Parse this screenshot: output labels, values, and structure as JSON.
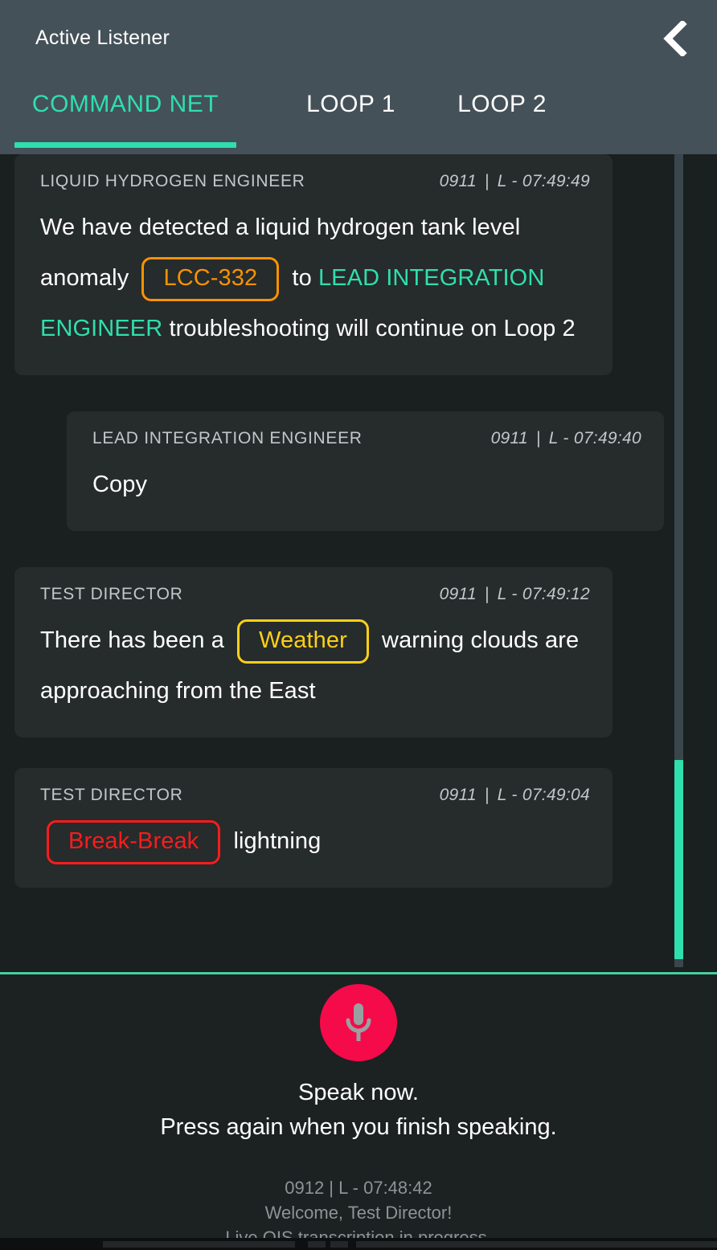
{
  "header": {
    "title": "Active Listener",
    "back_icon": "chevron-left-icon",
    "tabs": [
      {
        "label": "COMMAND NET",
        "active": true
      },
      {
        "label": "LOOP 1",
        "active": false
      },
      {
        "label": "LOOP 2",
        "active": false
      }
    ]
  },
  "colors": {
    "accent_green": "#2fdfae",
    "header_bg": "#455159",
    "card_bg": "#262b2c",
    "page_bg": "#1a1f20",
    "chip_orange": "#fb9200",
    "chip_yellow": "#fdd017",
    "chip_red": "#fa1c1c",
    "mic_red": "#f50a4a"
  },
  "messages": [
    {
      "speaker": "LIQUID HYDROGEN ENGINEER",
      "day": "0911",
      "time": "L - 07:49:49",
      "align": "left",
      "segments": [
        {
          "type": "text",
          "value": "We have detected a liquid hydrogen tank level anomaly "
        },
        {
          "type": "chip",
          "value": "LCC-332",
          "color": "orange"
        },
        {
          "type": "text",
          "value": " to "
        },
        {
          "type": "highlight",
          "value": "LEAD INTEGRATION ENGINEER"
        },
        {
          "type": "text",
          "value": " troubleshooting will continue on Loop 2"
        }
      ]
    },
    {
      "speaker": "LEAD INTEGRATION ENGINEER",
      "day": "0911",
      "time": "L - 07:49:40",
      "align": "indent",
      "segments": [
        {
          "type": "text",
          "value": "Copy"
        }
      ]
    },
    {
      "speaker": "TEST DIRECTOR",
      "day": "0911",
      "time": "L - 07:49:12",
      "align": "left",
      "segments": [
        {
          "type": "text",
          "value": "There has been a "
        },
        {
          "type": "chip",
          "value": "Weather",
          "color": "yellow"
        },
        {
          "type": "text",
          "value": " warning clouds are approaching from the East"
        }
      ]
    },
    {
      "speaker": "TEST DIRECTOR",
      "day": "0911",
      "time": "L - 07:49:04",
      "align": "left",
      "segments": [
        {
          "type": "chip",
          "value": "Break-Break",
          "color": "red"
        },
        {
          "type": "text",
          "value": " lightning"
        }
      ]
    }
  ],
  "mic_panel": {
    "mic_icon": "microphone-icon",
    "speak_line1": "Speak now.",
    "speak_line2": "Press again when you finish speaking.",
    "status_timestamp": "0912 | L - 07:48:42",
    "status_welcome": "Welcome, Test Director!",
    "status_transcription": "Live OIS transcription in progress."
  },
  "separator_meta": "|"
}
